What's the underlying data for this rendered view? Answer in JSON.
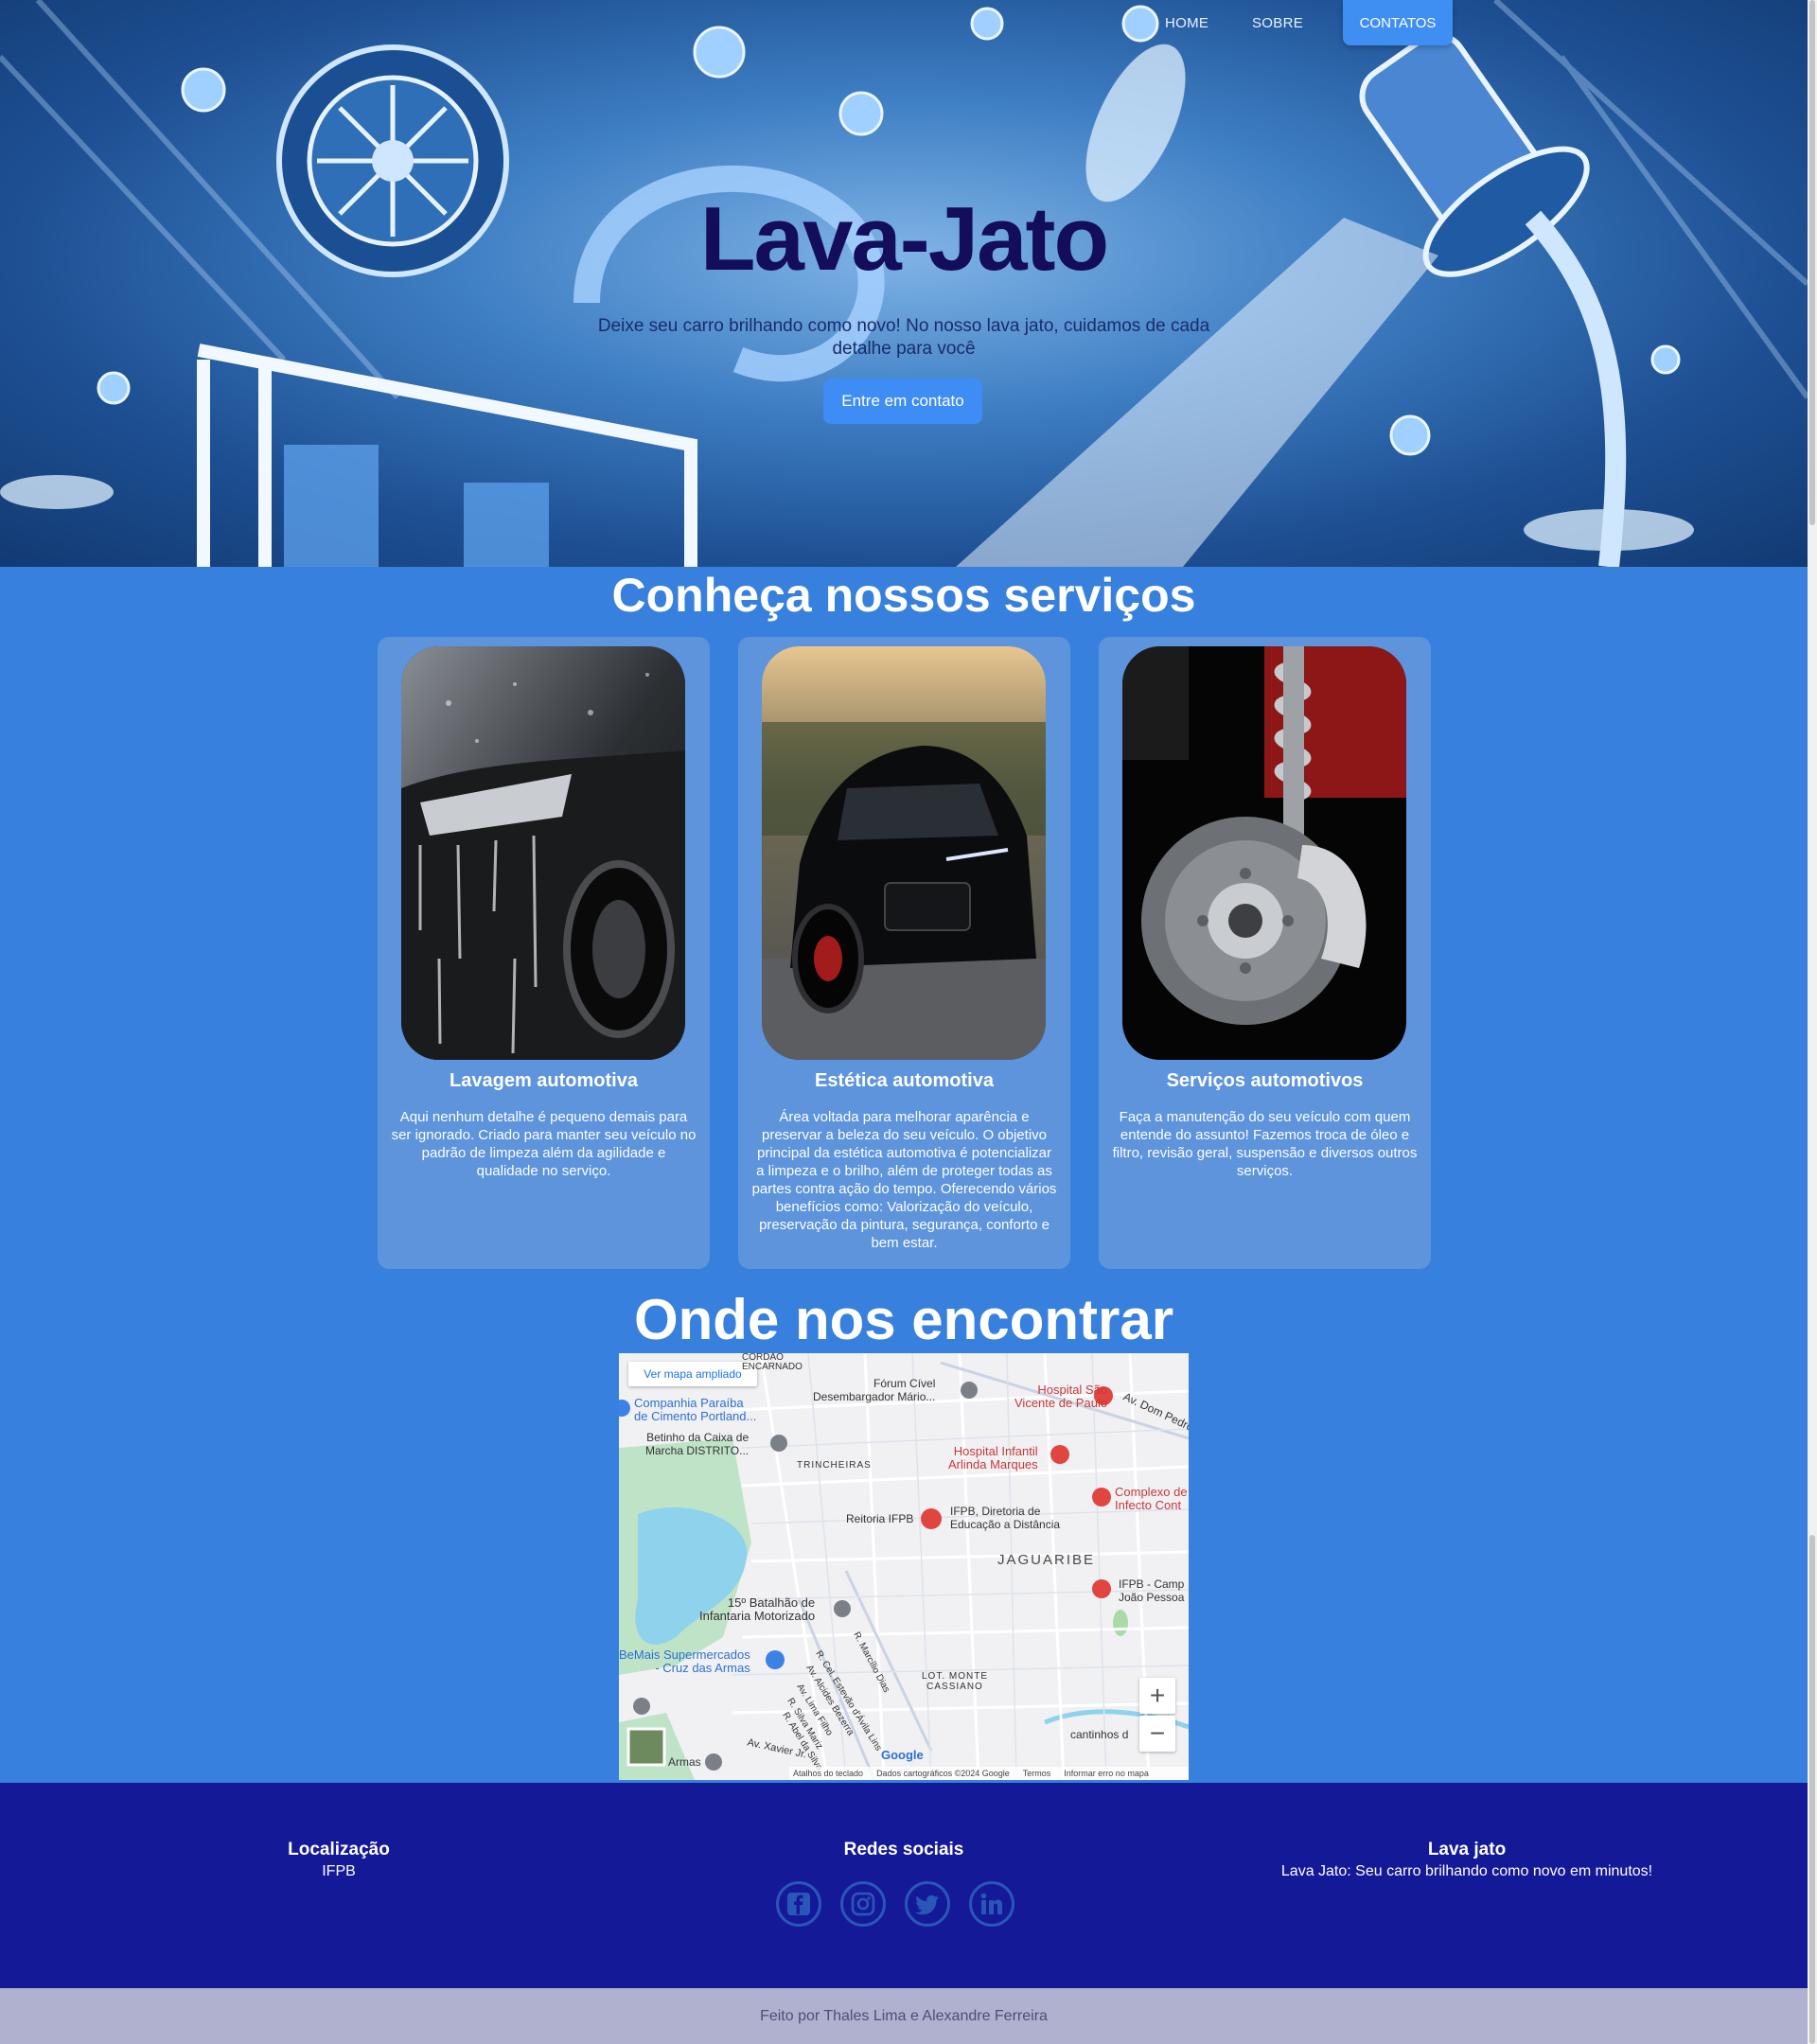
{
  "nav": {
    "items": [
      {
        "label": "HOME"
      },
      {
        "label": "SOBRE"
      }
    ],
    "cta_label": "CONTATOS"
  },
  "hero": {
    "title": "Lava-Jato",
    "subtitle": "Deixe seu carro brilhando como novo! No nosso lava jato, cuidamos de cada detalhe para você",
    "cta_label": "Entre em contato"
  },
  "services": {
    "title": "Conheça nossos serviços",
    "cards": [
      {
        "title": "Lavagem automotiva",
        "text": "Aqui nenhum detalhe é pequeno demais para ser ignorado. Criado para manter seu veículo no padrão de limpeza além da agilidade e qualidade no serviço."
      },
      {
        "title": "Estética automotiva",
        "text": "Área voltada para melhorar aparência e preservar a beleza do seu veículo. O objetivo principal da estética automotiva é potencializar a limpeza e o brilho, além de proteger todas as partes contra ação do tempo. Oferecendo vários benefícios como: Valorização do veículo, preservação da pintura, segurança, conforto e bem estar."
      },
      {
        "title": "Serviços automotivos",
        "text": "Faça a manutenção do seu veículo com quem entende do assunto! Fazemos troca de óleo e filtro, revisão geral, suspensão e diversos outros serviços."
      }
    ]
  },
  "map": {
    "title": "Onde nos encontrar",
    "view_larger": "Ver mapa ampliado",
    "places": {
      "forum": "Fórum Cível\nDesembargador Mário...",
      "hospital_sao_vicente": "Hospital São\nVicente de Paulo",
      "companhia": "Companhia Paraíba\nde Cimento Portland...",
      "betinho": "Betinho da Caixa de\nMarcha DISTRITO...",
      "trincheiras": "TRINCHEIRAS",
      "hospital_infantil": "Hospital Infantil\nArlinda Marques",
      "complexo": "Complexo de\nInfecto Cont",
      "reitoria": "Reitoria IFPB",
      "ifpb_diretoria": "IFPB, Diretoria de\nEducação a Distância",
      "jaguaribe": "JAGUARIBE",
      "ifpb_campus": "IFPB - Camp\nJoão Pessoa",
      "batalhao": "15º Batalhão de\nInfantaria Motorizado",
      "bemais": "BeMais Supermercados\n- Cruz das Armas",
      "monte_cassiano": "LOT. MONTE\nCASSIANO",
      "av_dom_pedro": "Av. Dom Pedro",
      "cordao": "CORDÃO\nENCARNADO",
      "r_marcilio": "R. Marcílio Dias",
      "r_cel": "R. Cel. Estevão d'Ávila Lins",
      "av_alcides": "Av. Alcides Bezerra",
      "av_lima": "Av. Lima Filho",
      "r_silva": "R. Silva Mariz",
      "r_abel": "R. Abel da Silva",
      "av_xavier": "Av. Xavier Jr.",
      "armas": "Armas",
      "cantinhos": "cantinhos d",
      "google": "Google"
    },
    "zoom_in": "+",
    "zoom_out": "−",
    "attribution": [
      "Atalhos do teclado",
      "Dados cartográficos ©2024 Google",
      "Termos",
      "Informar erro no mapa"
    ]
  },
  "footer": {
    "location_title": "Localização",
    "location_text": "IFPB",
    "social_title": "Redes sociais",
    "social_icons": [
      "facebook-icon",
      "instagram-icon",
      "twitter-icon",
      "linkedin-icon"
    ],
    "brand_title": "Lava jato",
    "brand_text": "Lava Jato: Seu carro brilhando como novo em minutos!",
    "credits": "Feito por Thales Lima e Alexandre Ferreira"
  },
  "colors": {
    "page_bg": "#3780dd",
    "card_bg": "#5d94dc",
    "footer_bg": "#141a97",
    "bottom_bar": "#afb1cf",
    "button": "#3f8ff3",
    "hero_title": "#130d5b"
  }
}
